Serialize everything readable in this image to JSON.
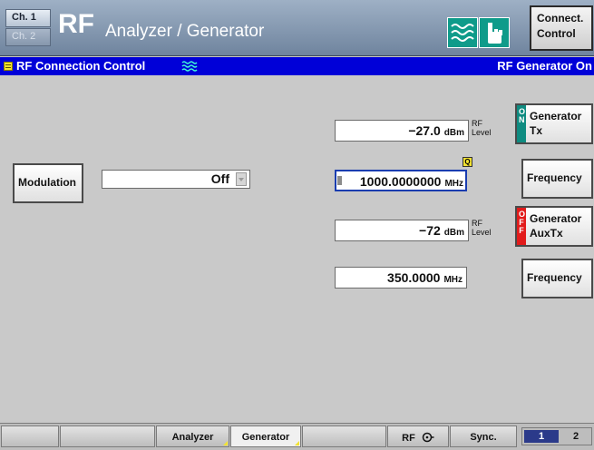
{
  "header": {
    "channel_1": "Ch. 1",
    "channel_2": "Ch. 2",
    "logo": "RF",
    "title": "Analyzer / Generator",
    "connect_control": [
      "Connect.",
      "Control"
    ]
  },
  "menu": {
    "title": "RF Connection Control",
    "status": "RF Generator On"
  },
  "modulation": {
    "button_label": "Modulation",
    "selected": "Off"
  },
  "generator_tx": {
    "level_value": "−27.0",
    "level_unit": "dBm",
    "level_label": [
      "RF",
      "Level"
    ],
    "frequency_value": "1000.0000000",
    "frequency_unit": "MHz",
    "state": "ON",
    "button_label": [
      "Generator",
      "Tx"
    ],
    "frequency_button": "Frequency"
  },
  "generator_aux": {
    "level_value": "−72",
    "level_unit": "dBm",
    "level_label": [
      "RF",
      "Level"
    ],
    "frequency_value": "350.0000",
    "frequency_unit": "MHz",
    "state": "OFF",
    "button_label": [
      "Generator",
      "AuxTx"
    ],
    "frequency_button": "Frequency"
  },
  "tabs": [
    {
      "label": ""
    },
    {
      "label": ""
    },
    {
      "label": "Analyzer"
    },
    {
      "label": "Generator"
    },
    {
      "label": ""
    },
    {
      "label": "RF"
    },
    {
      "label": "Sync."
    }
  ],
  "page_selector": {
    "page_1": "1",
    "page_2": "2"
  },
  "colors": {
    "menu_bar": "#0000d8",
    "generator_on": "#0e8b80",
    "generator_off": "#e21b1b",
    "accent_yellow": "#f2e230"
  }
}
